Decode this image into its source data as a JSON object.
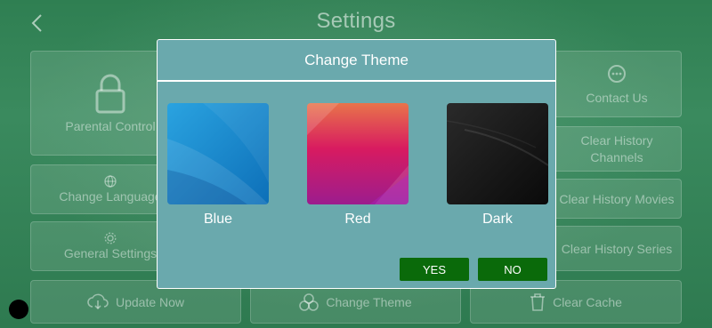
{
  "header": {
    "title": "Settings"
  },
  "tiles": {
    "parental_control": "Parental Control",
    "change_language": "Change Language",
    "general_settings": "General Settings",
    "contact_us": "Contact Us",
    "clear_history_channels": "Clear History Channels",
    "clear_history_movies": "Clear History Movies",
    "clear_history_series": "Clear History Series",
    "update_now": "Update Now",
    "change_theme": "Change Theme",
    "clear_cache": "Clear Cache"
  },
  "dialog": {
    "title": "Change Theme",
    "themes": [
      {
        "label": "Blue",
        "color": "#1e88cf"
      },
      {
        "label": "Red",
        "color": "#c2185b"
      },
      {
        "label": "Dark",
        "color": "#111111"
      }
    ],
    "yes_label": "YES",
    "no_label": "NO"
  },
  "colors": {
    "background": "#2f7f52",
    "dialog_bg": "#6aa9ad",
    "button_bg": "#0a6a0a"
  }
}
